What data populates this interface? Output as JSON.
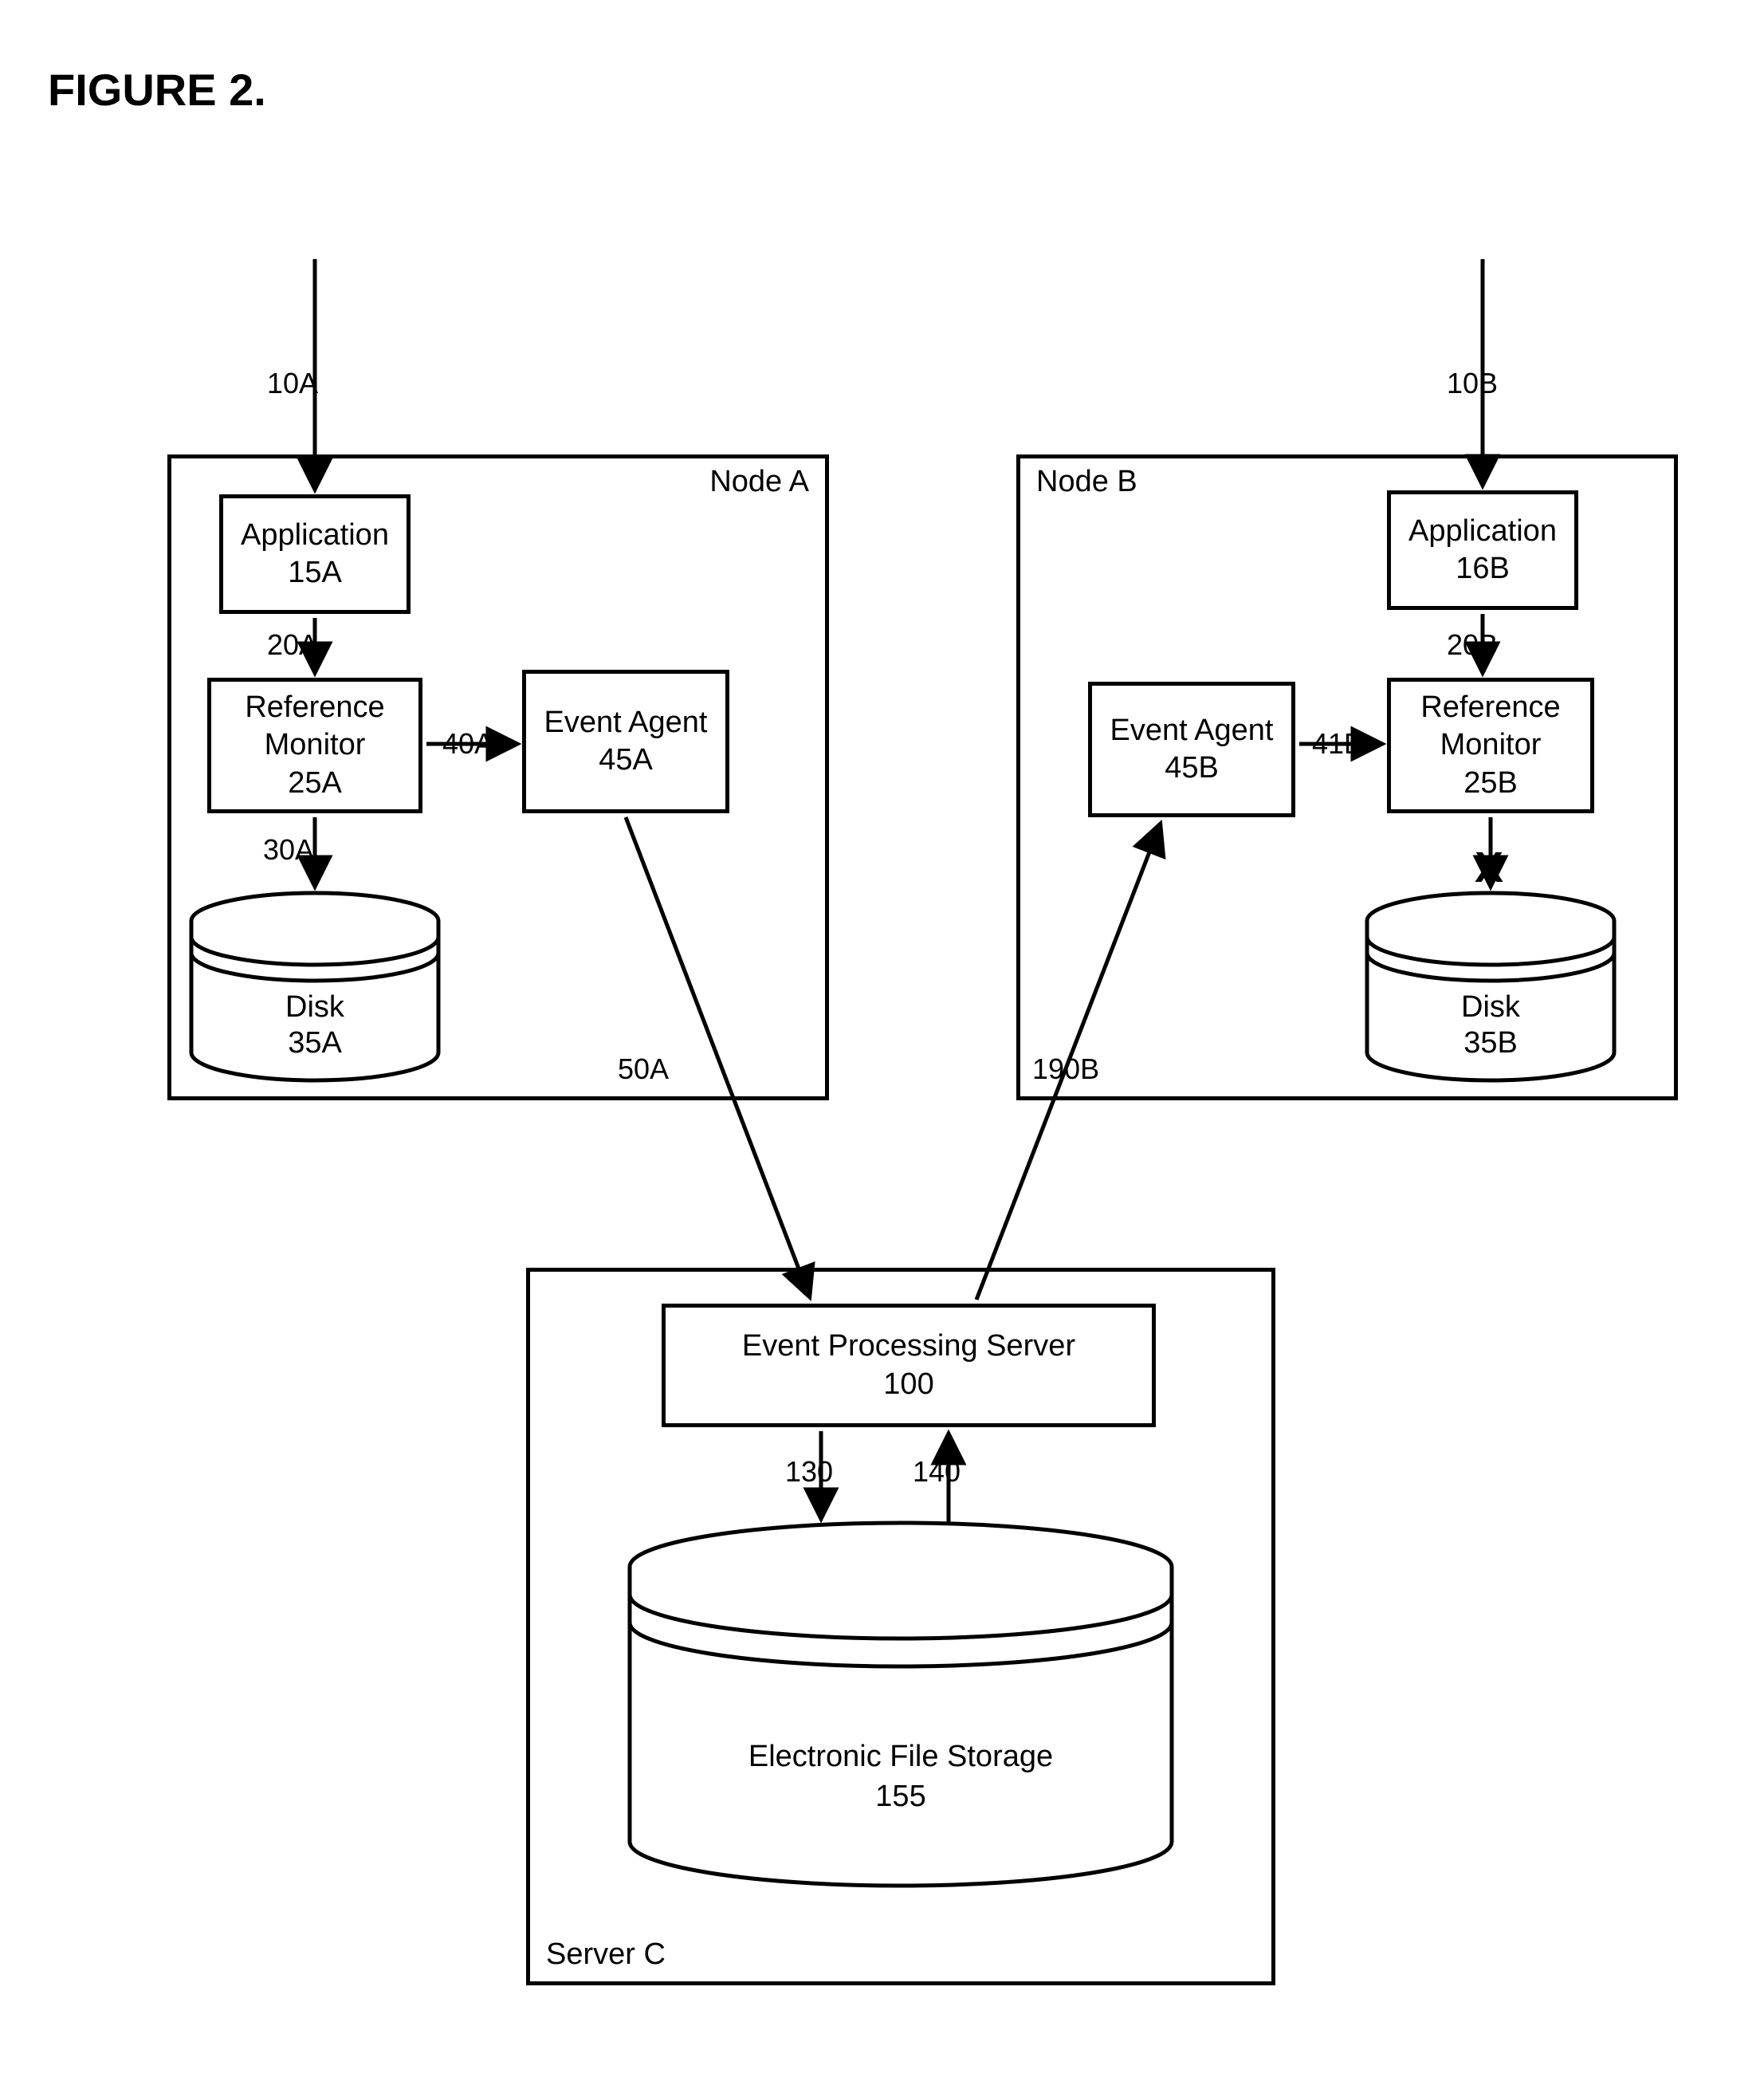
{
  "title": "FIGURE 2.",
  "nodeA": {
    "label": "Node A",
    "app": {
      "name": "Application",
      "id": "15A"
    },
    "ref": {
      "name": "Reference Monitor",
      "id": "25A"
    },
    "agent": {
      "name": "Event Agent",
      "id": "45A"
    },
    "disk": {
      "name": "Disk",
      "id": "35A"
    },
    "in": "10A",
    "e1": "20A",
    "e2": "30A",
    "e3": "40A",
    "out": "50A"
  },
  "nodeB": {
    "label": "Node B",
    "app": {
      "name": "Application",
      "id": "16B"
    },
    "ref": {
      "name": "Reference Monitor",
      "id": "25B"
    },
    "agent": {
      "name": "Event Agent",
      "id": "45B"
    },
    "disk": {
      "name": "Disk",
      "id": "35B"
    },
    "in": "10B",
    "e1": "20B",
    "e2": "41B",
    "inSrv": "190B",
    "block": "X"
  },
  "serverC": {
    "label": "Server C",
    "eps": {
      "name": "Event Processing Server",
      "id": "100"
    },
    "efs": {
      "name": "Electronic File Storage",
      "id": "155"
    },
    "e1": "130",
    "e2": "140"
  }
}
